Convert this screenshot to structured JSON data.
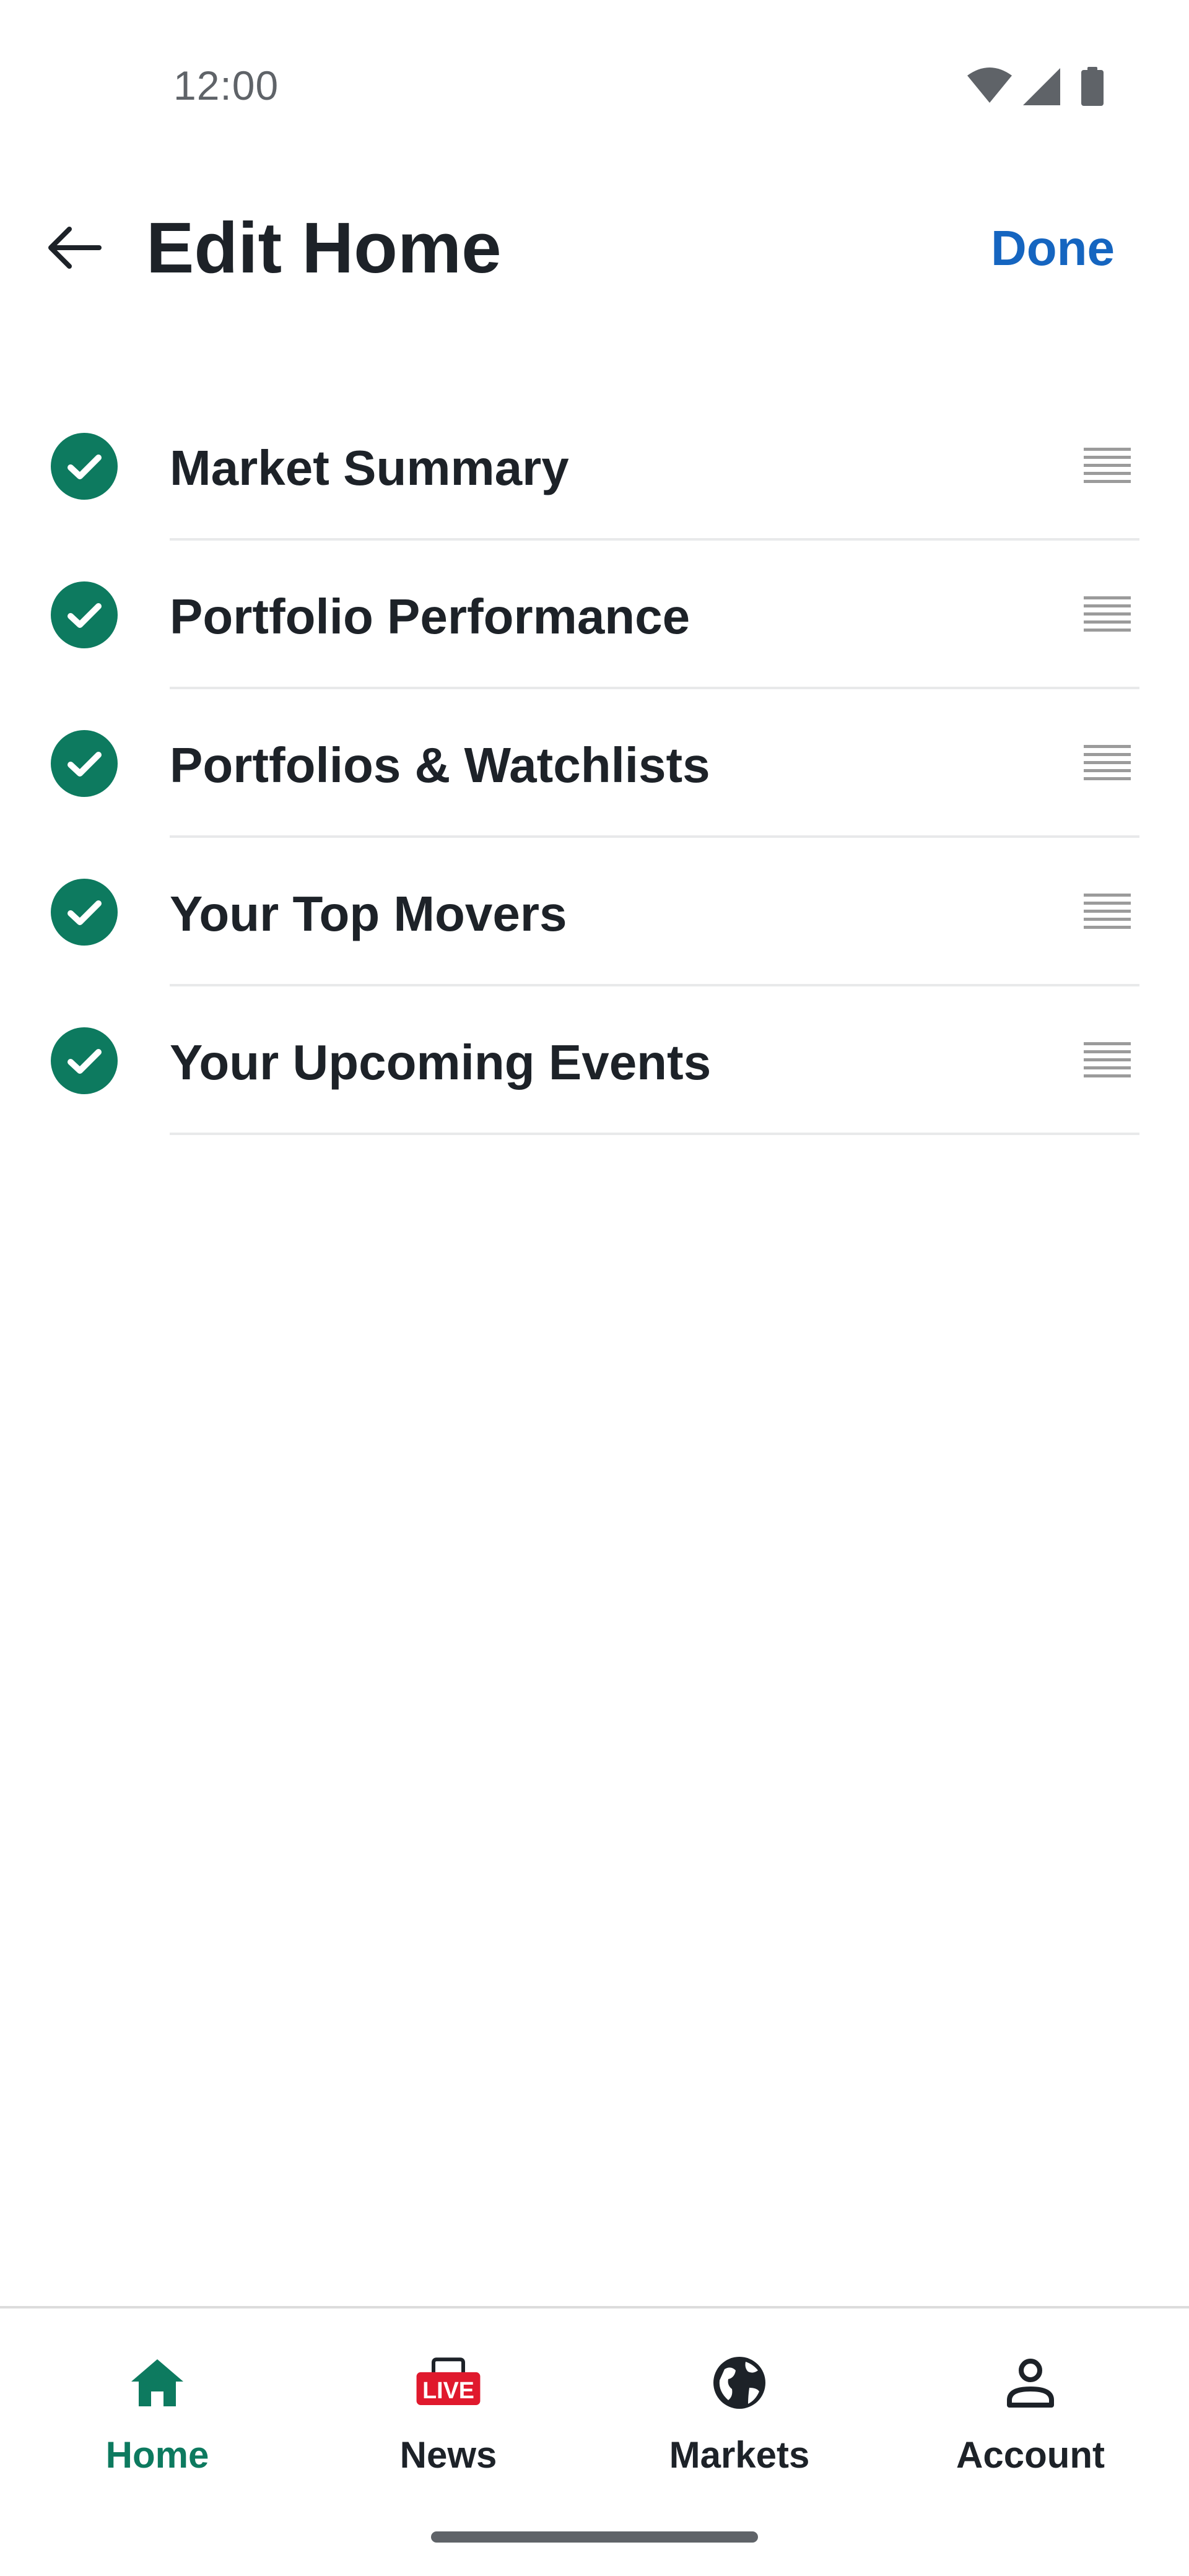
{
  "status_bar": {
    "time": "12:00",
    "icons": [
      "wifi-icon",
      "cellular-signal-icon",
      "battery-icon"
    ]
  },
  "header": {
    "back_icon": "arrow-left-icon",
    "title": "Edit Home",
    "done_label": "Done"
  },
  "modules": [
    {
      "label": "Market Summary",
      "enabled": true
    },
    {
      "label": "Portfolio Performance",
      "enabled": true
    },
    {
      "label": "Portfolios & Watchlists",
      "enabled": true
    },
    {
      "label": "Your Top Movers",
      "enabled": true
    },
    {
      "label": "Your Upcoming Events",
      "enabled": true
    }
  ],
  "bottom_nav": {
    "items": [
      {
        "label": "Home",
        "icon": "home-icon",
        "active": true
      },
      {
        "label": "News",
        "icon": "live-tv-icon",
        "badge": "LIVE",
        "active": false
      },
      {
        "label": "Markets",
        "icon": "globe-icon",
        "active": false
      },
      {
        "label": "Account",
        "icon": "person-icon",
        "active": false
      }
    ]
  },
  "colors": {
    "accent_green": "#0d7a5f",
    "link_blue": "#1565c0",
    "live_red": "#e0192d",
    "text_primary": "#1d2228"
  }
}
